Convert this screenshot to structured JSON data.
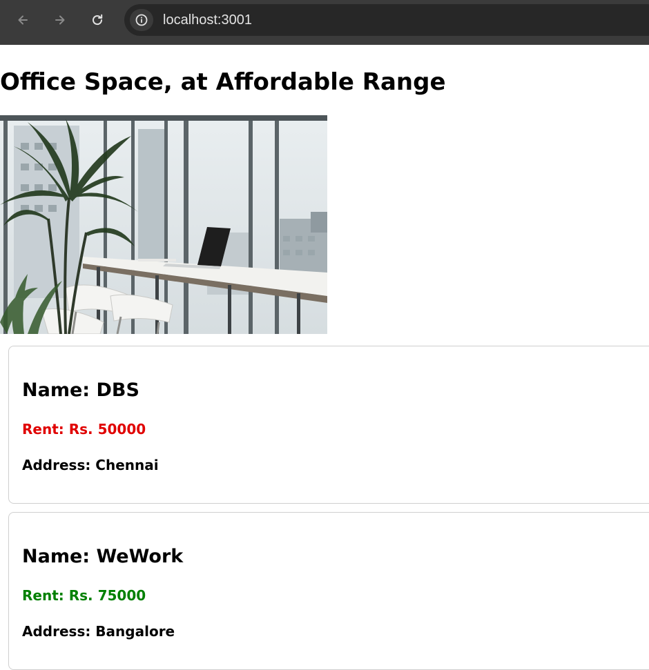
{
  "browser": {
    "url": "localhost:3001",
    "icons": {
      "back": "arrow-left-icon",
      "forward": "arrow-right-icon",
      "reload": "reload-icon",
      "site_info": "info-icon"
    },
    "colors": {
      "toolbar": "#3b3b3b",
      "omnibox": "#272727",
      "url_text": "#e3e3e3"
    }
  },
  "page": {
    "heading": "Office Space, at Affordable Range",
    "image": {
      "subject": "office interior with plant, long desk, laptop and large windows"
    }
  },
  "offices": [
    {
      "name_label": "Name: DBS",
      "rent_label": "Rent: Rs. 50000",
      "address_label": "Address: Chennai",
      "rent_color": "#e00000"
    },
    {
      "name_label": "Name: WeWork",
      "rent_label": "Rent: Rs. 75000",
      "address_label": "Address: Bangalore",
      "rent_color": "#008000"
    }
  ]
}
